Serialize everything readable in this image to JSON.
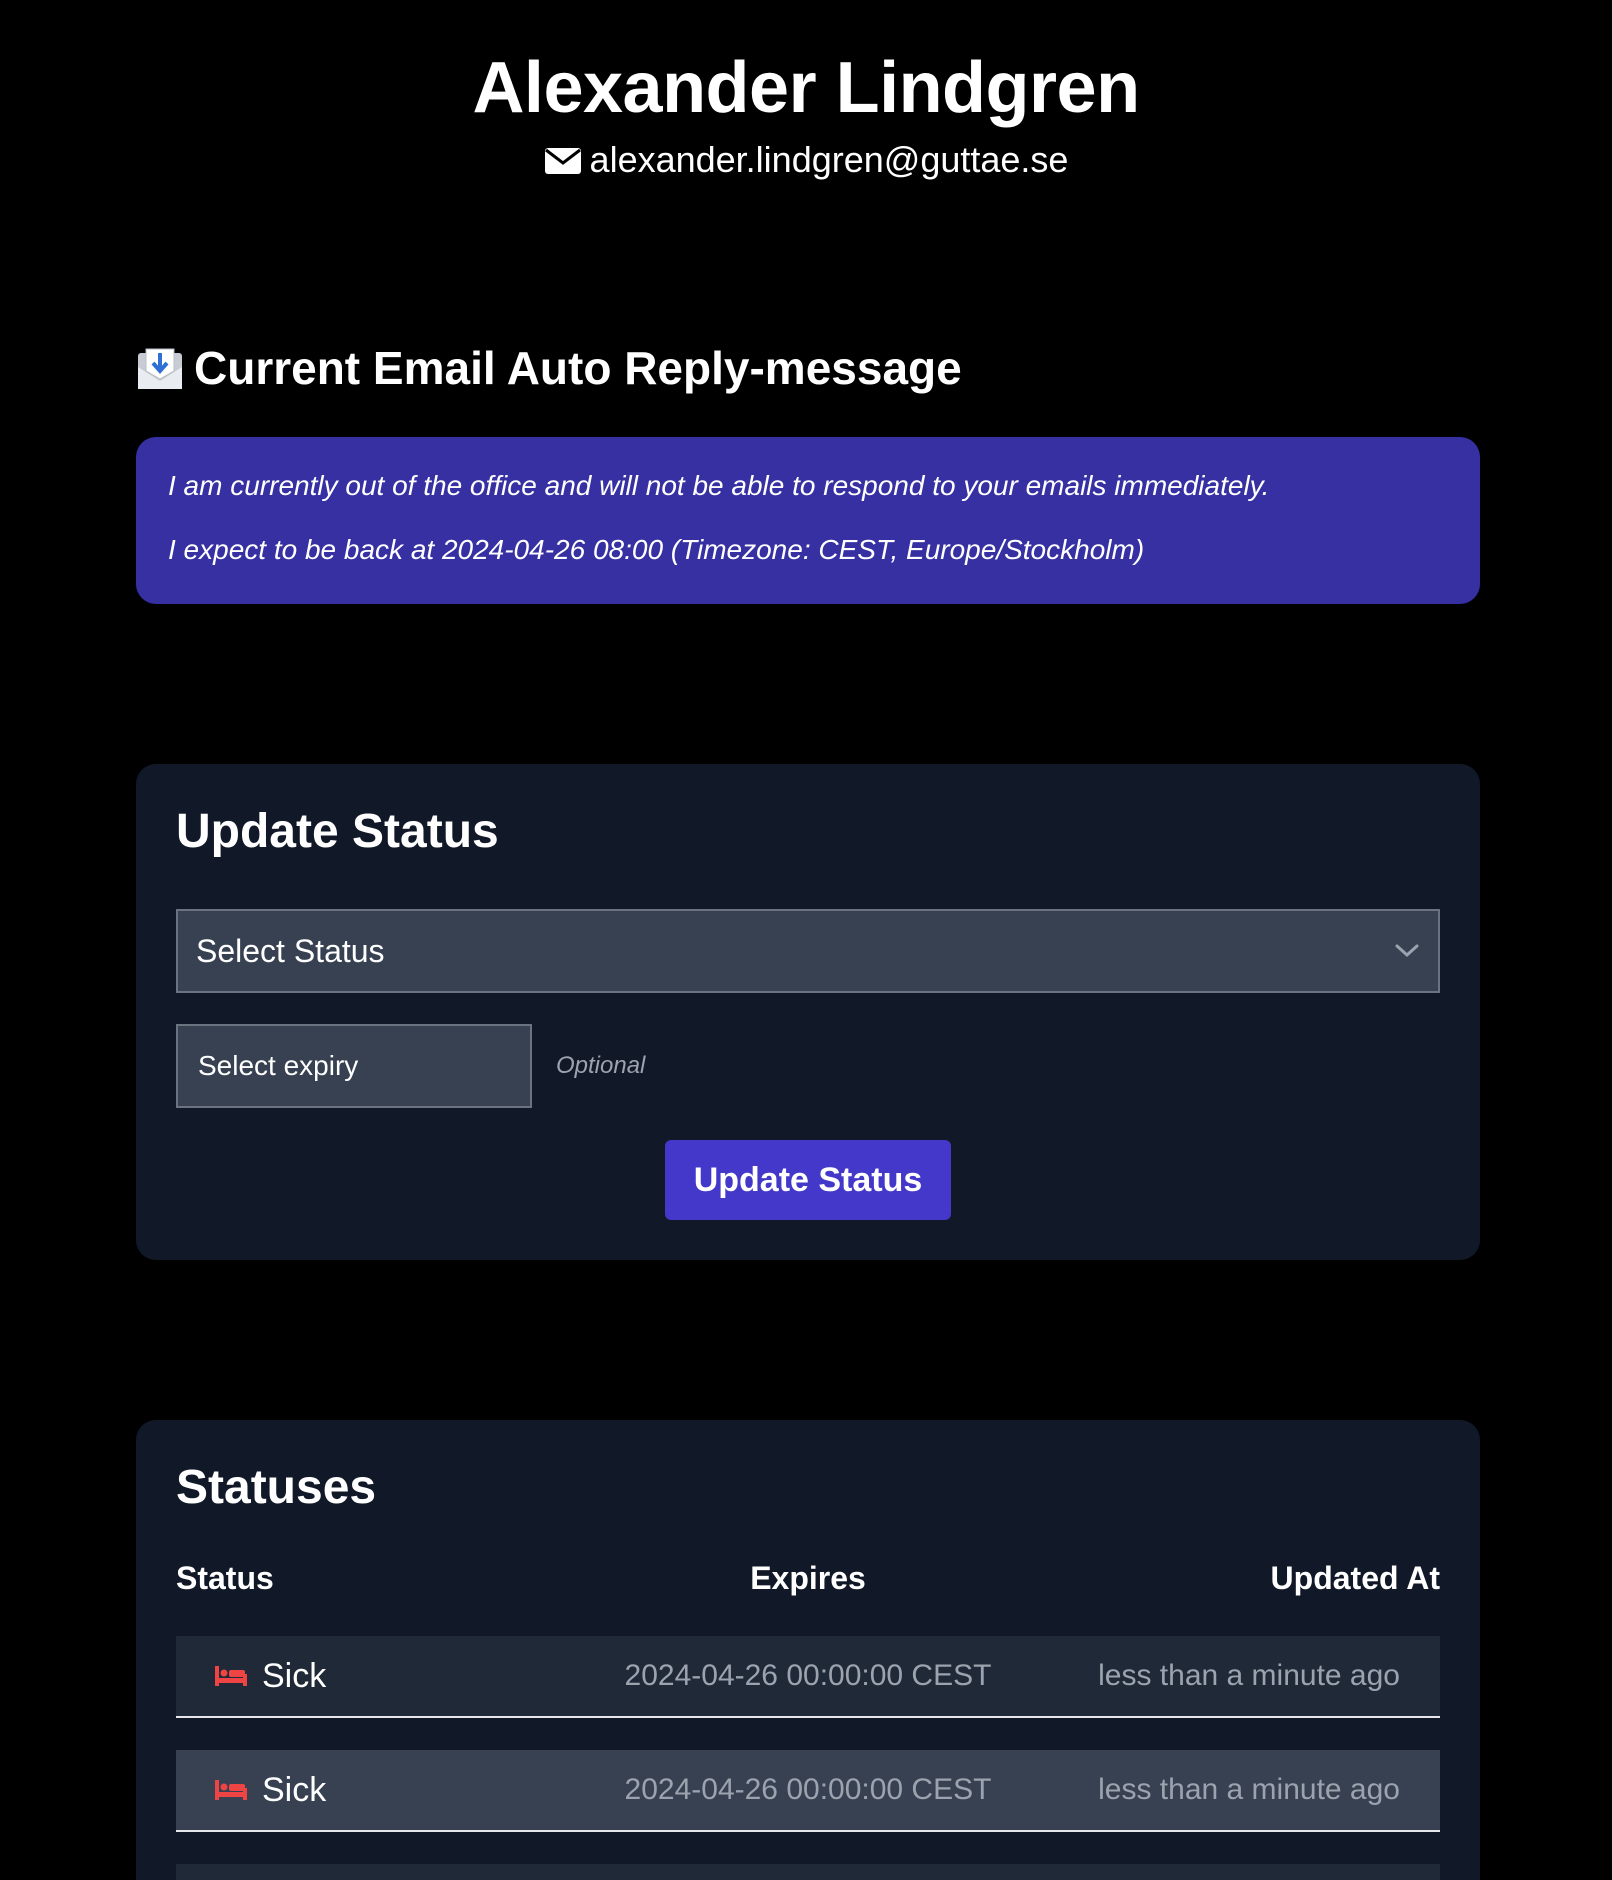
{
  "header": {
    "name": "Alexander Lindgren",
    "email": "alexander.lindgren@guttae.se",
    "email_icon": "envelope-icon"
  },
  "auto_reply": {
    "title": "Current Email Auto Reply-message",
    "title_icon": "envelope-with-arrow-icon",
    "lines": [
      "I am currently out of the office and will not be able to respond to your emails immediately.",
      "I expect to be back at 2024-04-26 08:00 (Timezone: CEST, Europe/Stockholm)"
    ],
    "background": "#3730a3"
  },
  "update_status": {
    "title": "Update Status",
    "status_select": {
      "value": "Select Status"
    },
    "expiry_input": {
      "placeholder": "Select expiry"
    },
    "optional_hint": "Optional",
    "submit_label": "Update Status",
    "button_color": "#4338ca"
  },
  "statuses": {
    "title": "Statuses",
    "columns": [
      "Status",
      "Expires",
      "Updated At"
    ],
    "rows": [
      {
        "status": "Sick",
        "icon": "bed-icon",
        "expires": "2024-04-26 00:00:00 CEST",
        "updated": "less than a minute ago"
      },
      {
        "status": "Sick",
        "icon": "bed-icon",
        "expires": "2024-04-26 00:00:00 CEST",
        "updated": "less than a minute ago"
      }
    ]
  },
  "colors": {
    "background": "#000000",
    "card": "#111827",
    "row_odd": "#1f2937",
    "row_even": "#374151",
    "sick_icon": "#ef4444"
  }
}
